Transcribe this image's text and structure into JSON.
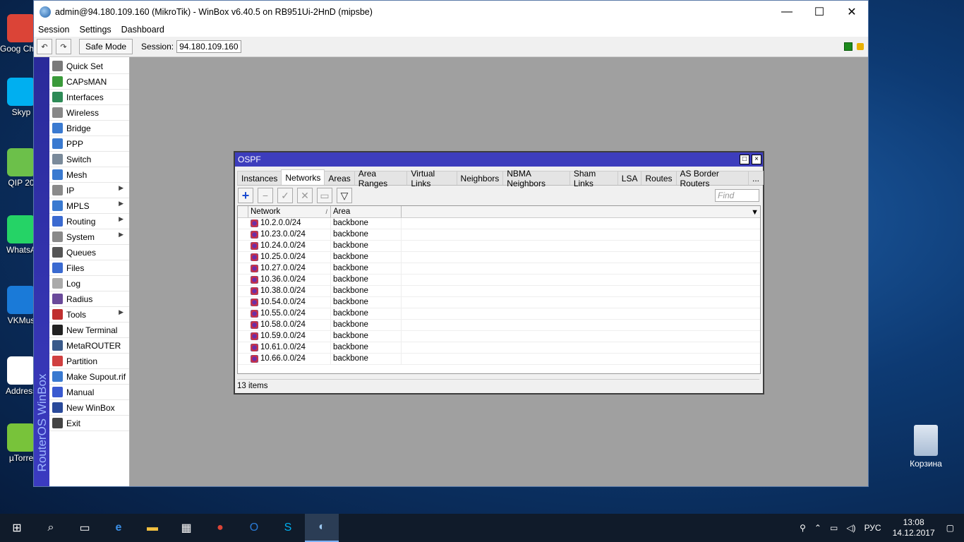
{
  "desktop": {
    "icons": [
      {
        "label": "Goog Chron",
        "color": "#db4437"
      },
      {
        "label": "Skyp",
        "color": "#00aff0"
      },
      {
        "label": "QIP 20",
        "color": "#6cc04a"
      },
      {
        "label": "WhatsA",
        "color": "#25d366"
      },
      {
        "label": "VKMus",
        "color": "#1a7ad8"
      },
      {
        "label": "Address",
        "color": "#ffffff"
      },
      {
        "label": "µTorre",
        "color": "#78c33a"
      }
    ],
    "recycle_bin": "Корзина"
  },
  "window": {
    "title": "admin@94.180.109.160 (MikroTik) - WinBox v6.40.5 on RB951Ui-2HnD (mipsbe)",
    "minimize": "—",
    "maximize": "☐",
    "close": "✕"
  },
  "menu": [
    "Session",
    "Settings",
    "Dashboard"
  ],
  "toolbar": {
    "undo_icon": "↶",
    "redo_icon": "↷",
    "safe_mode": "Safe Mode",
    "session_label": "Session:",
    "session_value": "94.180.109.160"
  },
  "sidestrip_text": "RouterOS WinBox",
  "sidebar": [
    {
      "label": "Quick Set",
      "icon": "quick-set-icon",
      "color": "#7a7a7a",
      "submenu": false
    },
    {
      "label": "CAPsMAN",
      "icon": "capsman-icon",
      "color": "#3a9a3a",
      "submenu": false
    },
    {
      "label": "Interfaces",
      "icon": "interfaces-icon",
      "color": "#2e8b57",
      "submenu": false
    },
    {
      "label": "Wireless",
      "icon": "wireless-icon",
      "color": "#888888",
      "submenu": false
    },
    {
      "label": "Bridge",
      "icon": "bridge-icon",
      "color": "#3a7ad0",
      "submenu": false
    },
    {
      "label": "PPP",
      "icon": "ppp-icon",
      "color": "#3a7ad0",
      "submenu": false
    },
    {
      "label": "Switch",
      "icon": "switch-icon",
      "color": "#7a8a9a",
      "submenu": false
    },
    {
      "label": "Mesh",
      "icon": "mesh-icon",
      "color": "#3a7ad0",
      "submenu": false
    },
    {
      "label": "IP",
      "icon": "ip-icon",
      "color": "#8a8a8a",
      "submenu": true
    },
    {
      "label": "MPLS",
      "icon": "mpls-icon",
      "color": "#3a7ad0",
      "submenu": true
    },
    {
      "label": "Routing",
      "icon": "routing-icon",
      "color": "#3a6ad0",
      "submenu": true
    },
    {
      "label": "System",
      "icon": "system-icon",
      "color": "#8a8a8a",
      "submenu": true
    },
    {
      "label": "Queues",
      "icon": "queues-icon",
      "color": "#555555",
      "submenu": false
    },
    {
      "label": "Files",
      "icon": "files-icon",
      "color": "#3a6ad0",
      "submenu": false
    },
    {
      "label": "Log",
      "icon": "log-icon",
      "color": "#aaaaaa",
      "submenu": false
    },
    {
      "label": "Radius",
      "icon": "radius-icon",
      "color": "#6a4a9a",
      "submenu": false
    },
    {
      "label": "Tools",
      "icon": "tools-icon",
      "color": "#c03030",
      "submenu": true
    },
    {
      "label": "New Terminal",
      "icon": "terminal-icon",
      "color": "#222222",
      "submenu": false
    },
    {
      "label": "MetaROUTER",
      "icon": "metarouter-icon",
      "color": "#3a5a8a",
      "submenu": false
    },
    {
      "label": "Partition",
      "icon": "partition-icon",
      "color": "#d04040",
      "submenu": false
    },
    {
      "label": "Make Supout.rif",
      "icon": "supout-icon",
      "color": "#3a7ad0",
      "submenu": false
    },
    {
      "label": "Manual",
      "icon": "manual-icon",
      "color": "#3a5ad0",
      "submenu": false
    },
    {
      "label": "New WinBox",
      "icon": "winbox-icon",
      "color": "#2a4a9a",
      "submenu": false
    },
    {
      "label": "Exit",
      "icon": "exit-icon",
      "color": "#444444",
      "submenu": false
    }
  ],
  "ospf": {
    "title": "OSPF",
    "tabs": [
      "Instances",
      "Networks",
      "Areas",
      "Area Ranges",
      "Virtual Links",
      "Neighbors",
      "NBMA Neighbors",
      "Sham Links",
      "LSA",
      "Routes",
      "AS Border Routers",
      "..."
    ],
    "active_tab": "Networks",
    "find_placeholder": "Find",
    "columns": {
      "network": "Network",
      "area": "Area"
    },
    "rows": [
      {
        "network": "10.2.0.0/24",
        "area": "backbone"
      },
      {
        "network": "10.23.0.0/24",
        "area": "backbone"
      },
      {
        "network": "10.24.0.0/24",
        "area": "backbone"
      },
      {
        "network": "10.25.0.0/24",
        "area": "backbone"
      },
      {
        "network": "10.27.0.0/24",
        "area": "backbone"
      },
      {
        "network": "10.36.0.0/24",
        "area": "backbone"
      },
      {
        "network": "10.38.0.0/24",
        "area": "backbone"
      },
      {
        "network": "10.54.0.0/24",
        "area": "backbone"
      },
      {
        "network": "10.55.0.0/24",
        "area": "backbone"
      },
      {
        "network": "10.58.0.0/24",
        "area": "backbone"
      },
      {
        "network": "10.59.0.0/24",
        "area": "backbone"
      },
      {
        "network": "10.61.0.0/24",
        "area": "backbone"
      },
      {
        "network": "10.66.0.0/24",
        "area": "backbone"
      }
    ],
    "status": "13 items"
  },
  "taskbar": {
    "lang": "РУС",
    "time": "13:08",
    "date": "14.12.2017"
  }
}
